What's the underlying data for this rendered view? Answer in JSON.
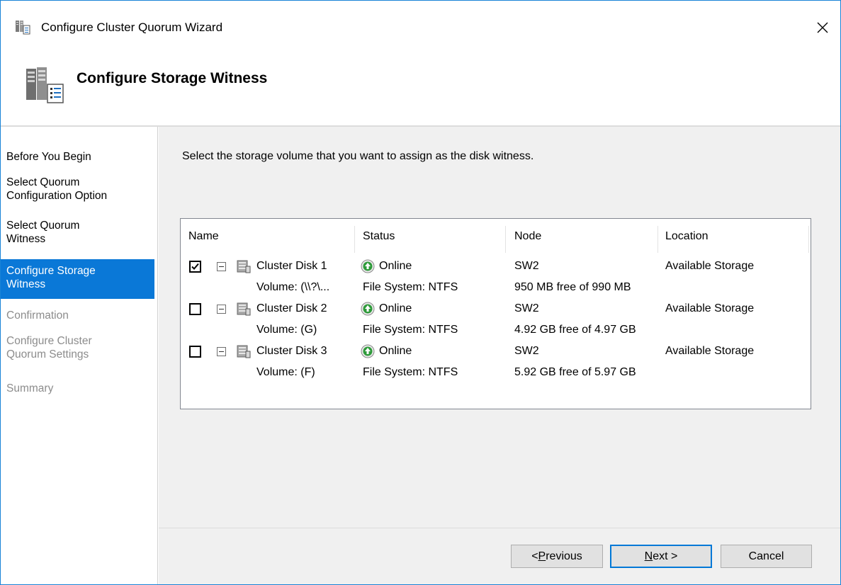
{
  "window": {
    "title": "Configure Cluster Quorum Wizard"
  },
  "header": {
    "title": "Configure Storage Witness"
  },
  "nav": {
    "items": [
      {
        "label": "Before You Begin",
        "state": "normal"
      },
      {
        "label": "Select Quorum\nConfiguration Option",
        "state": "normal"
      },
      {
        "label": "Select Quorum\nWitness",
        "state": "normal"
      },
      {
        "label": "Configure Storage\nWitness",
        "state": "active"
      },
      {
        "label": "Confirmation",
        "state": "disabled"
      },
      {
        "label": "Configure Cluster\nQuorum Settings",
        "state": "disabled"
      },
      {
        "label": "Summary",
        "state": "disabled"
      }
    ]
  },
  "main": {
    "instruction": "Select the storage volume that you want to assign as the disk witness.",
    "columns": [
      "Name",
      "Status",
      "Node",
      "Location"
    ],
    "rows": [
      {
        "checked": true,
        "name": "Cluster Disk 1",
        "status": "Online",
        "node": "SW2",
        "location": "Available Storage",
        "volume": "Volume: (\\\\?\\...",
        "filesystem": "File System: NTFS",
        "free": "950 MB free of 990 MB"
      },
      {
        "checked": false,
        "name": "Cluster Disk 2",
        "status": "Online",
        "node": "SW2",
        "location": "Available Storage",
        "volume": "Volume: (G)",
        "filesystem": "File System: NTFS",
        "free": "4.92 GB free of 4.97 GB"
      },
      {
        "checked": false,
        "name": "Cluster Disk 3",
        "status": "Online",
        "node": "SW2",
        "location": "Available Storage",
        "volume": "Volume: (F)",
        "filesystem": "File System: NTFS",
        "free": "5.92 GB free of 5.97 GB"
      }
    ]
  },
  "buttons": {
    "previous_prefix": "< ",
    "previous_accel": "P",
    "previous_rest": "revious",
    "next_accel": "N",
    "next_rest": "ext >",
    "cancel": "Cancel"
  },
  "colors": {
    "accent": "#0a78d7",
    "online_green": "#2e9a3a"
  },
  "icons": {
    "close": "close-icon",
    "wizard": "cluster-wizard-icon",
    "disk": "cluster-disk-icon",
    "online": "online-status-icon"
  }
}
